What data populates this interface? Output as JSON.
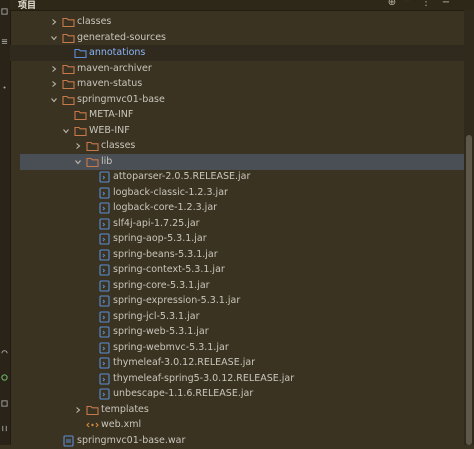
{
  "panel": {
    "title": "项目"
  },
  "tree": [
    {
      "label": "classes",
      "depth": 3,
      "expanded": false,
      "icon": "folder"
    },
    {
      "label": "generated-sources",
      "depth": 3,
      "expanded": true,
      "icon": "folder"
    },
    {
      "label": "annotations",
      "depth": 4,
      "icon": "source-folder",
      "blue": true
    },
    {
      "label": "maven-archiver",
      "depth": 3,
      "expanded": false,
      "icon": "folder"
    },
    {
      "label": "maven-status",
      "depth": 3,
      "expanded": false,
      "icon": "folder"
    },
    {
      "label": "springmvc01-base",
      "depth": 3,
      "expanded": true,
      "icon": "folder"
    },
    {
      "label": "META-INF",
      "depth": 4,
      "icon": "folder"
    },
    {
      "label": "WEB-INF",
      "depth": 4,
      "expanded": true,
      "icon": "folder"
    },
    {
      "label": "classes",
      "depth": 5,
      "expanded": false,
      "icon": "folder"
    },
    {
      "label": "lib",
      "depth": 5,
      "expanded": true,
      "icon": "folder",
      "selected": true
    },
    {
      "label": "attoparser-2.0.5.RELEASE.jar",
      "depth": 6,
      "icon": "jar"
    },
    {
      "label": "logback-classic-1.2.3.jar",
      "depth": 6,
      "icon": "jar"
    },
    {
      "label": "logback-core-1.2.3.jar",
      "depth": 6,
      "icon": "jar"
    },
    {
      "label": "slf4j-api-1.7.25.jar",
      "depth": 6,
      "icon": "jar"
    },
    {
      "label": "spring-aop-5.3.1.jar",
      "depth": 6,
      "icon": "jar"
    },
    {
      "label": "spring-beans-5.3.1.jar",
      "depth": 6,
      "icon": "jar"
    },
    {
      "label": "spring-context-5.3.1.jar",
      "depth": 6,
      "icon": "jar"
    },
    {
      "label": "spring-core-5.3.1.jar",
      "depth": 6,
      "icon": "jar"
    },
    {
      "label": "spring-expression-5.3.1.jar",
      "depth": 6,
      "icon": "jar"
    },
    {
      "label": "spring-jcl-5.3.1.jar",
      "depth": 6,
      "icon": "jar"
    },
    {
      "label": "spring-web-5.3.1.jar",
      "depth": 6,
      "icon": "jar"
    },
    {
      "label": "spring-webmvc-5.3.1.jar",
      "depth": 6,
      "icon": "jar"
    },
    {
      "label": "thymeleaf-3.0.12.RELEASE.jar",
      "depth": 6,
      "icon": "jar"
    },
    {
      "label": "thymeleaf-spring5-3.0.12.RELEASE.jar",
      "depth": 6,
      "icon": "jar"
    },
    {
      "label": "unbescape-1.1.6.RELEASE.jar",
      "depth": 6,
      "icon": "jar"
    },
    {
      "label": "templates",
      "depth": 5,
      "expanded": false,
      "icon": "folder"
    },
    {
      "label": "web.xml",
      "depth": 5,
      "icon": "xml"
    },
    {
      "label": "springmvc01-base.war",
      "depth": 3,
      "icon": "war"
    }
  ],
  "colors": {
    "folder": "#c8794b",
    "jar": "#5b8ed6",
    "selection": "#4a4f55"
  }
}
